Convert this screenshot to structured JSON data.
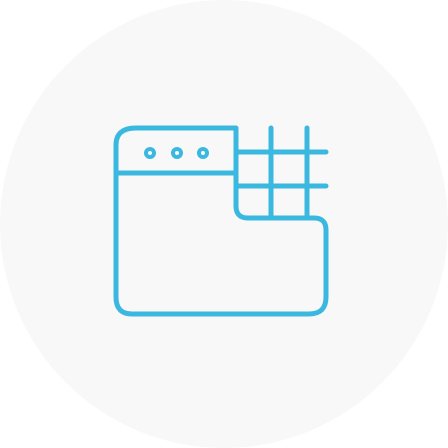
{
  "icon": {
    "name": "browser-window-grid-icon",
    "stroke_color": "#3bb8e0",
    "background_color": "#f8f8f8"
  }
}
